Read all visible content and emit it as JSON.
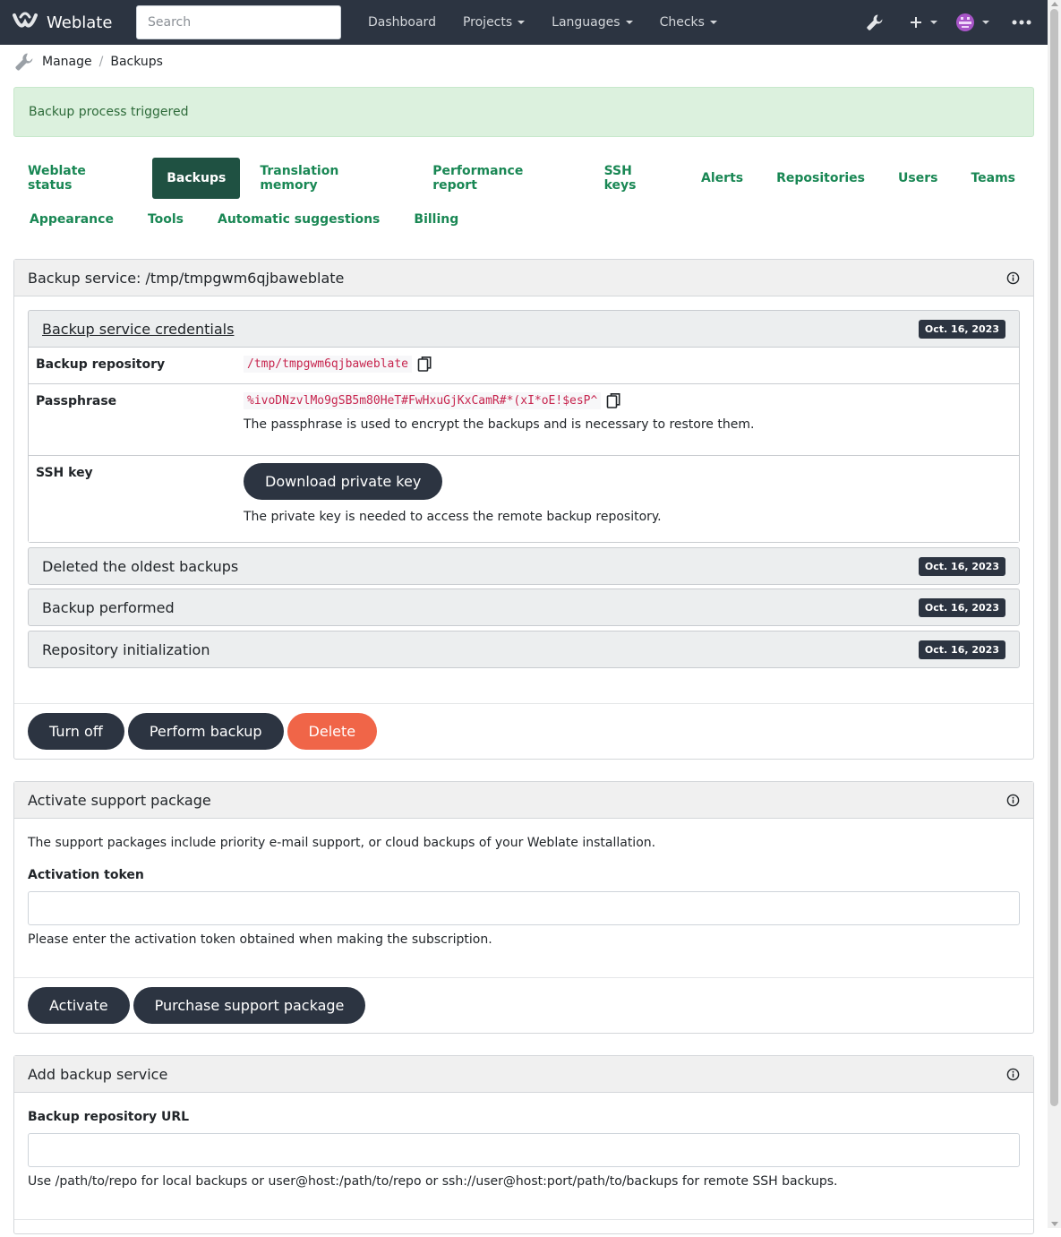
{
  "nav": {
    "brand": "Weblate",
    "search_placeholder": "Search",
    "links": [
      {
        "label": "Dashboard"
      },
      {
        "label": "Projects"
      },
      {
        "label": "Languages"
      },
      {
        "label": "Checks"
      }
    ]
  },
  "breadcrumb": {
    "manage": "Manage",
    "separator": "/",
    "current": "Backups"
  },
  "alert": {
    "message": "Backup process triggered"
  },
  "tabs": [
    [
      "Weblate status",
      "Backups",
      "Translation memory",
      "Performance report",
      "SSH keys",
      "Alerts",
      "Repositories",
      "Users",
      "Teams"
    ],
    [
      "Appearance",
      "Tools",
      "Automatic suggestions",
      "Billing"
    ]
  ],
  "active_tab": "Backups",
  "backup_service": {
    "title": "Backup service: /tmp/tmpgwm6qjbaweblate",
    "credentials_title": "Backup service credentials",
    "credentials_date": "Oct. 16, 2023",
    "repository_label": "Backup repository",
    "repository_value": "/tmp/tmpgwm6qjbaweblate",
    "passphrase_label": "Passphrase",
    "passphrase_value": "%ivoDNzvlMo9gSB5m80HeT#FwHxuGjKxCamR#*(xI*oE!$esP^",
    "passphrase_help": "The passphrase is used to encrypt the backups and is necessary to restore them.",
    "ssh_label": "SSH key",
    "ssh_button": "Download private key",
    "ssh_help": "The private key is needed to access the remote backup repository.",
    "logs": [
      {
        "title": "Deleted the oldest backups",
        "date": "Oct. 16, 2023"
      },
      {
        "title": "Backup performed",
        "date": "Oct. 16, 2023"
      },
      {
        "title": "Repository initialization",
        "date": "Oct. 16, 2023"
      }
    ],
    "buttons": {
      "turn_off": "Turn off",
      "perform": "Perform backup",
      "delete": "Delete"
    }
  },
  "support": {
    "title": "Activate support package",
    "description": "The support packages include priority e-mail support, or cloud backups of your Weblate installation.",
    "token_label": "Activation token",
    "token_value": "",
    "token_help": "Please enter the activation token obtained when making the subscription.",
    "buttons": {
      "activate": "Activate",
      "purchase": "Purchase support package"
    }
  },
  "add_backup": {
    "title": "Add backup service",
    "url_label": "Backup repository URL",
    "url_value": "",
    "url_help": "Use /path/to/repo for local backups or user@host:/path/to/repo or ssh://user@host:port/path/to/backups for remote SSH backups."
  },
  "colors": {
    "navbar": "#2c3441",
    "accent": "#198754",
    "active_tab": "#1f5142",
    "danger": "#f06548",
    "alert_bg": "#dcf1de"
  },
  "icons": [
    "weblate-logo-icon",
    "wrench-icon",
    "plus-icon",
    "avatar-icon",
    "more-icon",
    "info-icon",
    "copy-icon"
  ]
}
